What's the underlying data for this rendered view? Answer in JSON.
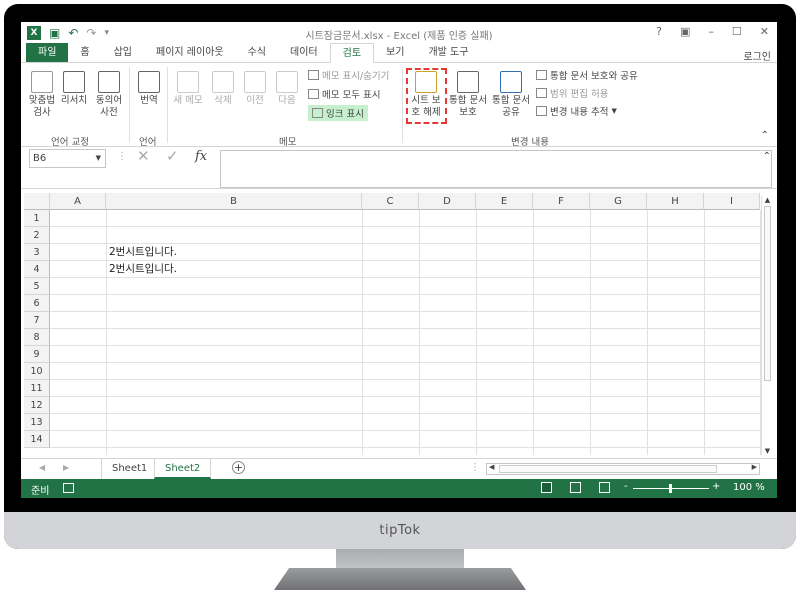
{
  "window": {
    "title": "시트잠금문서.xlsx - Excel (제품 인증 실패)",
    "help": "?",
    "minimize": "–",
    "restore": "☐",
    "close": "✕"
  },
  "qat": {
    "undo": "↶",
    "redo": "↷",
    "more": "▾"
  },
  "tabs": [
    "파일",
    "홈",
    "삽입",
    "페이지 레이아웃",
    "수식",
    "데이터",
    "검토",
    "보기",
    "개발 도구"
  ],
  "active_tab": "검토",
  "login": "로그인",
  "ribbon": {
    "proofing": {
      "spell": "맞춤법\n검사",
      "thesaurus": "리서치",
      "synonyms": "동의어\n사전",
      "group": "언어 교정"
    },
    "language": {
      "translate": "번역",
      "group": "언어"
    },
    "comments": {
      "new": "새 메모",
      "delete": "삭제",
      "prev": "이전",
      "next": "다음",
      "show_hide": "메모 표시/숨기기",
      "show_all": "메모 모두 표시",
      "ink": "잉크 표시",
      "group": "메모"
    },
    "changes": {
      "unprotect_sheet": "시트 보\n호 해제",
      "protect_workbook": "통합 문서\n보호",
      "share_workbook": "통합 문서\n공유",
      "protect_share": "통합 문서 보호와 공유",
      "allow_ranges": "범위 편집 허용",
      "track_changes": "변경 내용 추적",
      "group": "변경 내용"
    }
  },
  "formula_bar": {
    "name_box": "B6",
    "fx": "fx"
  },
  "columns": [
    "A",
    "B",
    "C",
    "D",
    "E",
    "F",
    "G",
    "H",
    "I"
  ],
  "rows": [
    "1",
    "2",
    "3",
    "4",
    "5",
    "6",
    "7",
    "8",
    "9",
    "10",
    "11",
    "12",
    "13",
    "14"
  ],
  "cells": {
    "B3": "2번시트입니다.",
    "B4": "2번시트입니다."
  },
  "sheets": [
    "Sheet1",
    "Sheet2"
  ],
  "active_sheet": "Sheet2",
  "status": {
    "ready": "준비",
    "zoom": "100 %"
  },
  "brand": "tipTok"
}
